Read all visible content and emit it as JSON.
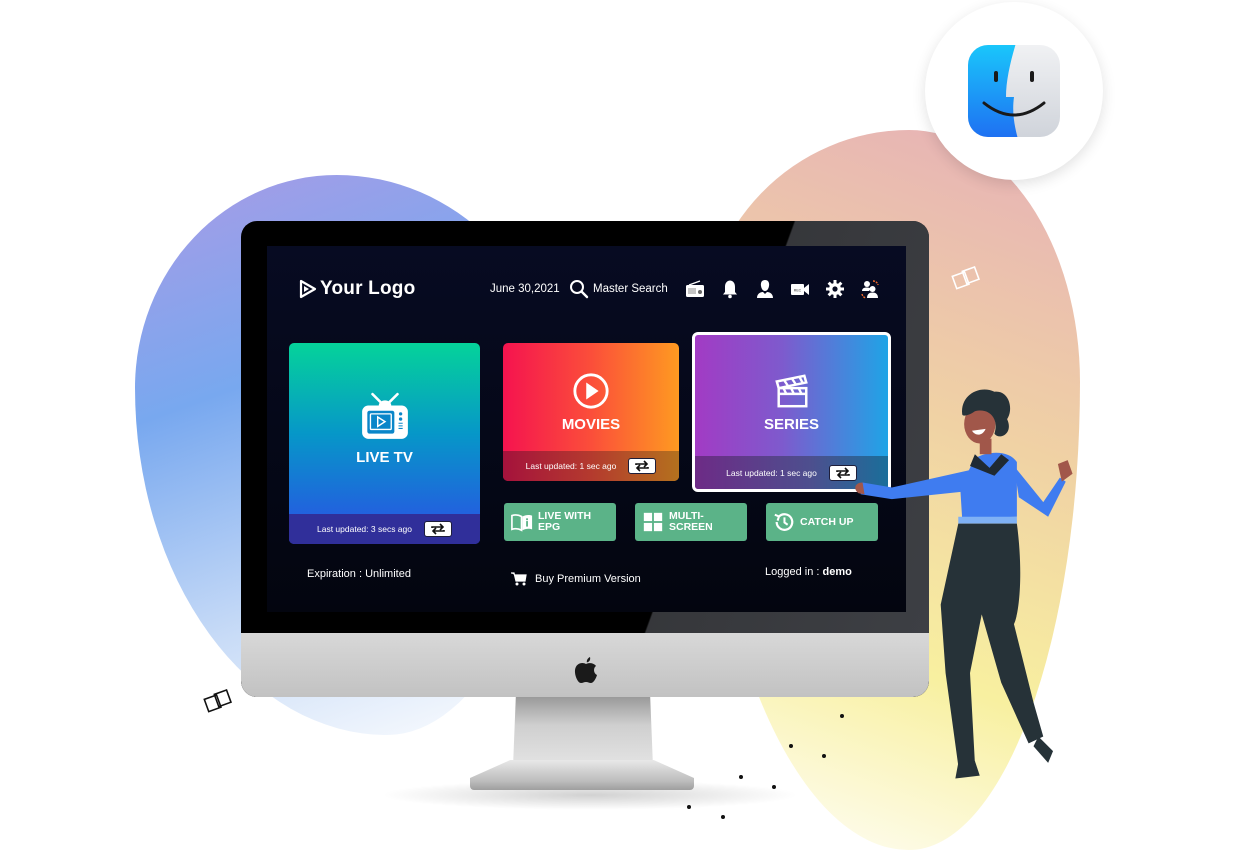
{
  "app": {
    "logo_text": "Your Logo",
    "date": "June 30,2021",
    "search_label": "Master Search",
    "header_icons": [
      "radio-icon",
      "bell-icon",
      "user-icon",
      "record-camera-icon",
      "gear-icon",
      "switch-user-icon"
    ]
  },
  "cards": {
    "live_tv": {
      "title": "LIVE TV",
      "updated": "Last updated: 3 secs ago",
      "icon": "tv-icon"
    },
    "movies": {
      "title": "MOVIES",
      "updated": "Last updated: 1 sec ago",
      "icon": "play-circle-icon"
    },
    "series": {
      "title": "SERIES",
      "updated": "Last updated: 1 sec ago",
      "icon": "clapperboard-icon",
      "selected": true
    }
  },
  "actions": {
    "epg_line1": "LIVE WITH",
    "epg_line2": "EPG",
    "multi": "MULTI-SCREEN",
    "catch": "CATCH UP"
  },
  "footer": {
    "expiration": "Expiration : Unlimited",
    "buy": "Buy Premium Version",
    "logged_prefix": "Logged in : ",
    "logged_user": "demo"
  },
  "colors": {
    "screen_bg": "#070b22",
    "action_green": "#5bb388",
    "live_gradient": [
      "#05d39a",
      "#2c4ee6"
    ],
    "movies_gradient": [
      "#f5134f",
      "#fe9a21"
    ],
    "series_gradient": [
      "#a23bc4",
      "#1fa4e6"
    ]
  }
}
